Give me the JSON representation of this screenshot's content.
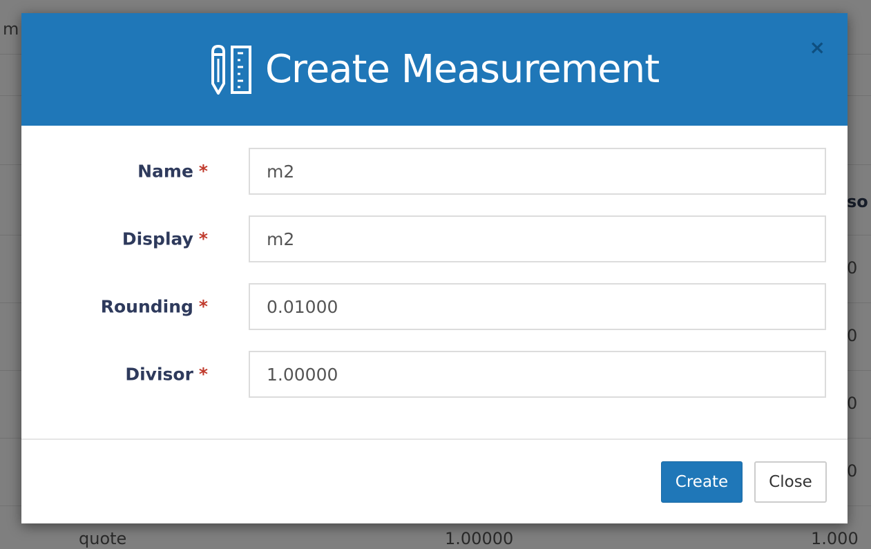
{
  "background": {
    "top_left_fragment": "m",
    "right_header_fragment": "so",
    "right_values": [
      "0",
      "0",
      "0",
      "0"
    ],
    "bottom_row": {
      "name": "quote",
      "rounding": "1.00000",
      "divisor": "1.000"
    }
  },
  "modal": {
    "title": "Create Measurement",
    "title_icon": "ruler-pencil-icon",
    "close_label": "×",
    "required_marker": "*",
    "fields": [
      {
        "label": "Name",
        "value": "m2"
      },
      {
        "label": "Display",
        "value": "m2"
      },
      {
        "label": "Rounding",
        "value": "0.01000"
      },
      {
        "label": "Divisor",
        "value": "1.00000"
      }
    ],
    "buttons": {
      "create_label": "Create",
      "close_label": "Close"
    }
  },
  "colors": {
    "header_blue": "#1f77b8",
    "label_navy": "#2e3a5c",
    "required_red": "#c0392b"
  }
}
